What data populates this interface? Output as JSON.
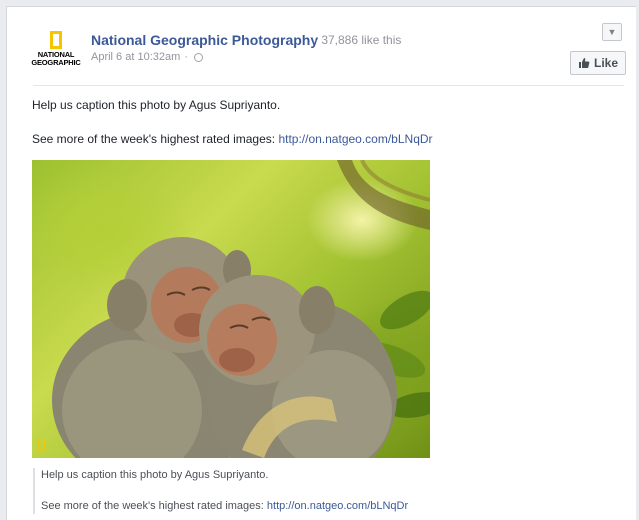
{
  "post": {
    "page_name": "National Geographic Photography",
    "likes_text": "· 37,886 like this",
    "timestamp": "April 6 at 10:32am",
    "separator": "·",
    "like_label": "Like",
    "logo_line1": "NATIONAL",
    "logo_line2": "GEOGRAPHIC",
    "message_line1": "Help us caption this photo by Agus Supriyanto.",
    "message_line2_prefix": "See more of the week's highest rated images:",
    "message_link": "http://on.natgeo.com/bLNqDr"
  },
  "photo": {
    "alt": "two macaque monkeys hugging with eyes closed",
    "caption_line1": "Help us caption this photo by Agus Supriyanto.",
    "caption_line2_prefix": "See more of the week's highest rated images:",
    "caption_link": "http://on.natgeo.com/bLNqDr"
  },
  "colors": {
    "link": "#3b5998",
    "background": "#e9ebee",
    "natgeo_yellow": "#f6c500"
  },
  "icons": [
    "dropdown-chevron-icon",
    "globe-icon",
    "thumbs-up-icon",
    "natgeo-logo"
  ]
}
